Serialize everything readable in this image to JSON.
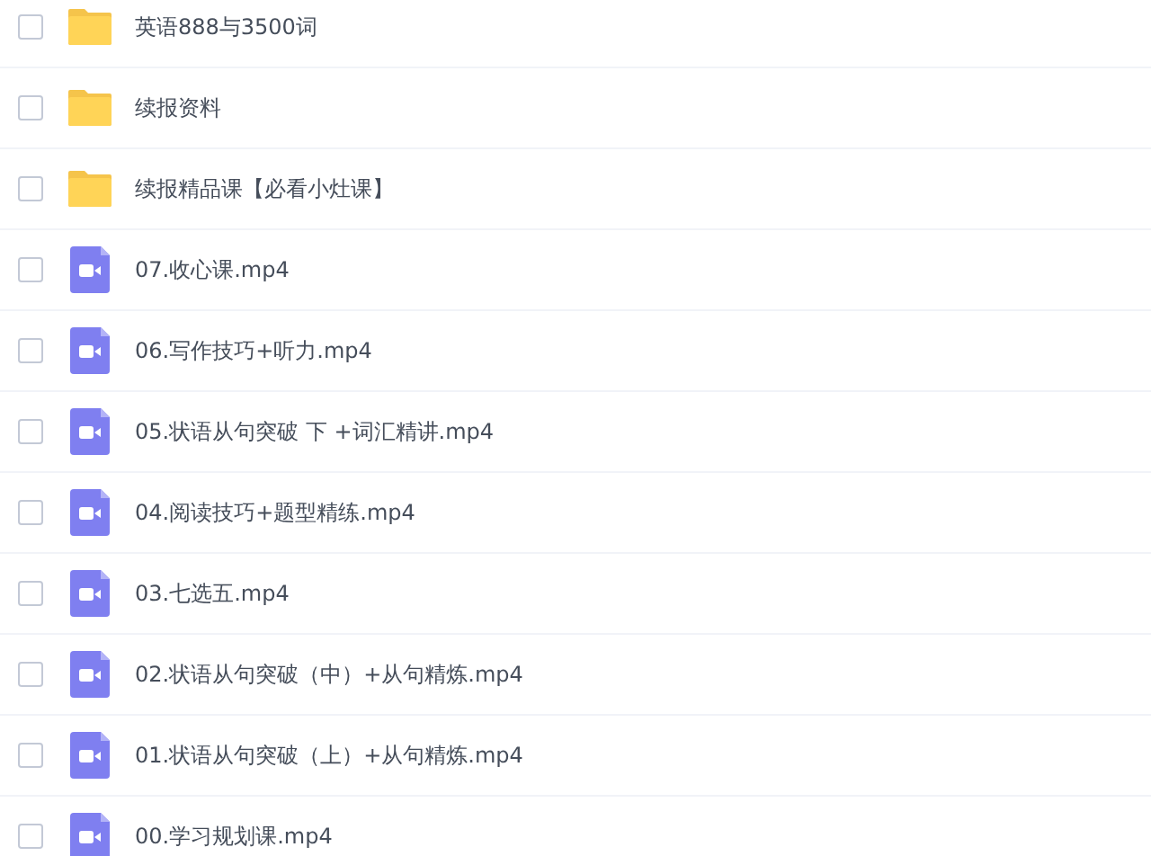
{
  "files": [
    {
      "kind": "folder",
      "name": "英语888与3500词",
      "checked": false
    },
    {
      "kind": "folder",
      "name": "续报资料",
      "checked": false
    },
    {
      "kind": "folder",
      "name": "续报精品课【必看小灶课】",
      "checked": false
    },
    {
      "kind": "video",
      "name": "07.收心课.mp4",
      "checked": false
    },
    {
      "kind": "video",
      "name": "06.写作技巧+听力.mp4",
      "checked": false
    },
    {
      "kind": "video",
      "name": "05.状语从句突破 下 +词汇精讲.mp4",
      "checked": false
    },
    {
      "kind": "video",
      "name": "04.阅读技巧+题型精练.mp4",
      "checked": false
    },
    {
      "kind": "video",
      "name": "03.七选五.mp4",
      "checked": false
    },
    {
      "kind": "video",
      "name": "02.状语从句突破（中）+从句精炼.mp4",
      "checked": false
    },
    {
      "kind": "video",
      "name": "01.状语从句突破（上）+从句精炼.mp4",
      "checked": false
    },
    {
      "kind": "video",
      "name": "00.学习规划课.mp4",
      "checked": false
    }
  ]
}
